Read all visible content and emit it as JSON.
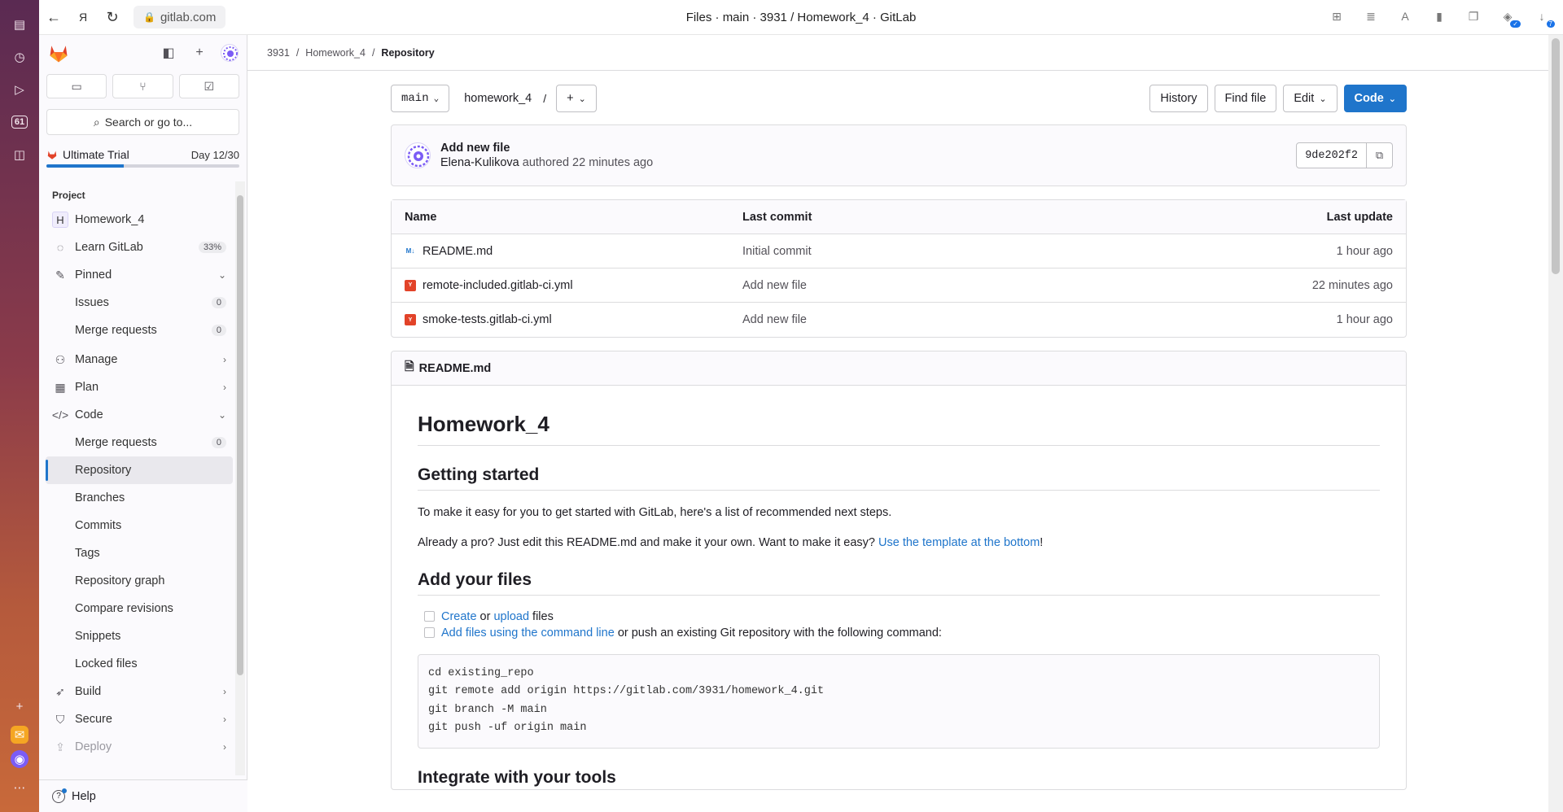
{
  "browser": {
    "url": "gitlab.com",
    "title": "Files · main · 3931 / Homework_4 · GitLab",
    "rail_badge": "61"
  },
  "sidebar": {
    "search_label": "Search or go to...",
    "trial": {
      "label": "Ultimate Trial",
      "day": "Day 12/30",
      "progress": 0.4
    },
    "section_title": "Project",
    "project_initial": "H",
    "project_name": "Homework_4",
    "learn_label": "Learn GitLab",
    "learn_pct": "33%",
    "pinned_label": "Pinned",
    "pinned": [
      {
        "label": "Issues",
        "count": "0"
      },
      {
        "label": "Merge requests",
        "count": "0"
      }
    ],
    "manage_label": "Manage",
    "plan_label": "Plan",
    "code_label": "Code",
    "code_items": {
      "merge_requests": "Merge requests",
      "merge_requests_count": "0",
      "repository": "Repository",
      "branches": "Branches",
      "commits": "Commits",
      "tags": "Tags",
      "graph": "Repository graph",
      "compare": "Compare revisions",
      "snippets": "Snippets",
      "locked": "Locked files"
    },
    "build_label": "Build",
    "secure_label": "Secure",
    "deploy_label": "Deploy",
    "help_label": "Help"
  },
  "breadcrumb": {
    "group": "3931",
    "project": "Homework_4",
    "current": "Repository"
  },
  "toolbar": {
    "branch": "main",
    "path": "homework_4",
    "separator": "/",
    "history": "History",
    "find_file": "Find file",
    "edit": "Edit",
    "code": "Code"
  },
  "commit": {
    "title": "Add new file",
    "author": "Elena-Kulikova",
    "meta": "authored 22 minutes ago",
    "sha": "9de202f2"
  },
  "files": {
    "headers": {
      "name": "Name",
      "last_commit": "Last commit",
      "last_update": "Last update"
    },
    "rows": [
      {
        "name": "README.md",
        "commit": "Initial commit",
        "updated": "1 hour ago",
        "icon": "md"
      },
      {
        "name": "remote-included.gitlab-ci.yml",
        "commit": "Add new file",
        "updated": "22 minutes ago",
        "icon": "yml"
      },
      {
        "name": "smoke-tests.gitlab-ci.yml",
        "commit": "Add new file",
        "updated": "1 hour ago",
        "icon": "yml"
      }
    ]
  },
  "readme": {
    "file_label": "README.md",
    "h1": "Homework_4",
    "getting_started": "Getting started",
    "p1": "To make it easy for you to get started with GitLab, here's a list of recommended next steps.",
    "p2_pre": "Already a pro? Just edit this README.md and make it your own. Want to make it easy? ",
    "p2_link": "Use the template at the bottom",
    "p2_post": "!",
    "add_files": "Add your files",
    "task1_link1": "Create",
    "task1_mid": " or ",
    "task1_link2": "upload",
    "task1_post": " files",
    "task2_link": "Add files using the command line",
    "task2_post": " or push an existing Git repository with the following command:",
    "code_lines": [
      "cd existing_repo",
      "git remote add origin https://gitlab.com/3931/homework_4.git",
      "git branch -M main",
      "git push -uf origin main"
    ],
    "integrate": "Integrate with your tools"
  }
}
